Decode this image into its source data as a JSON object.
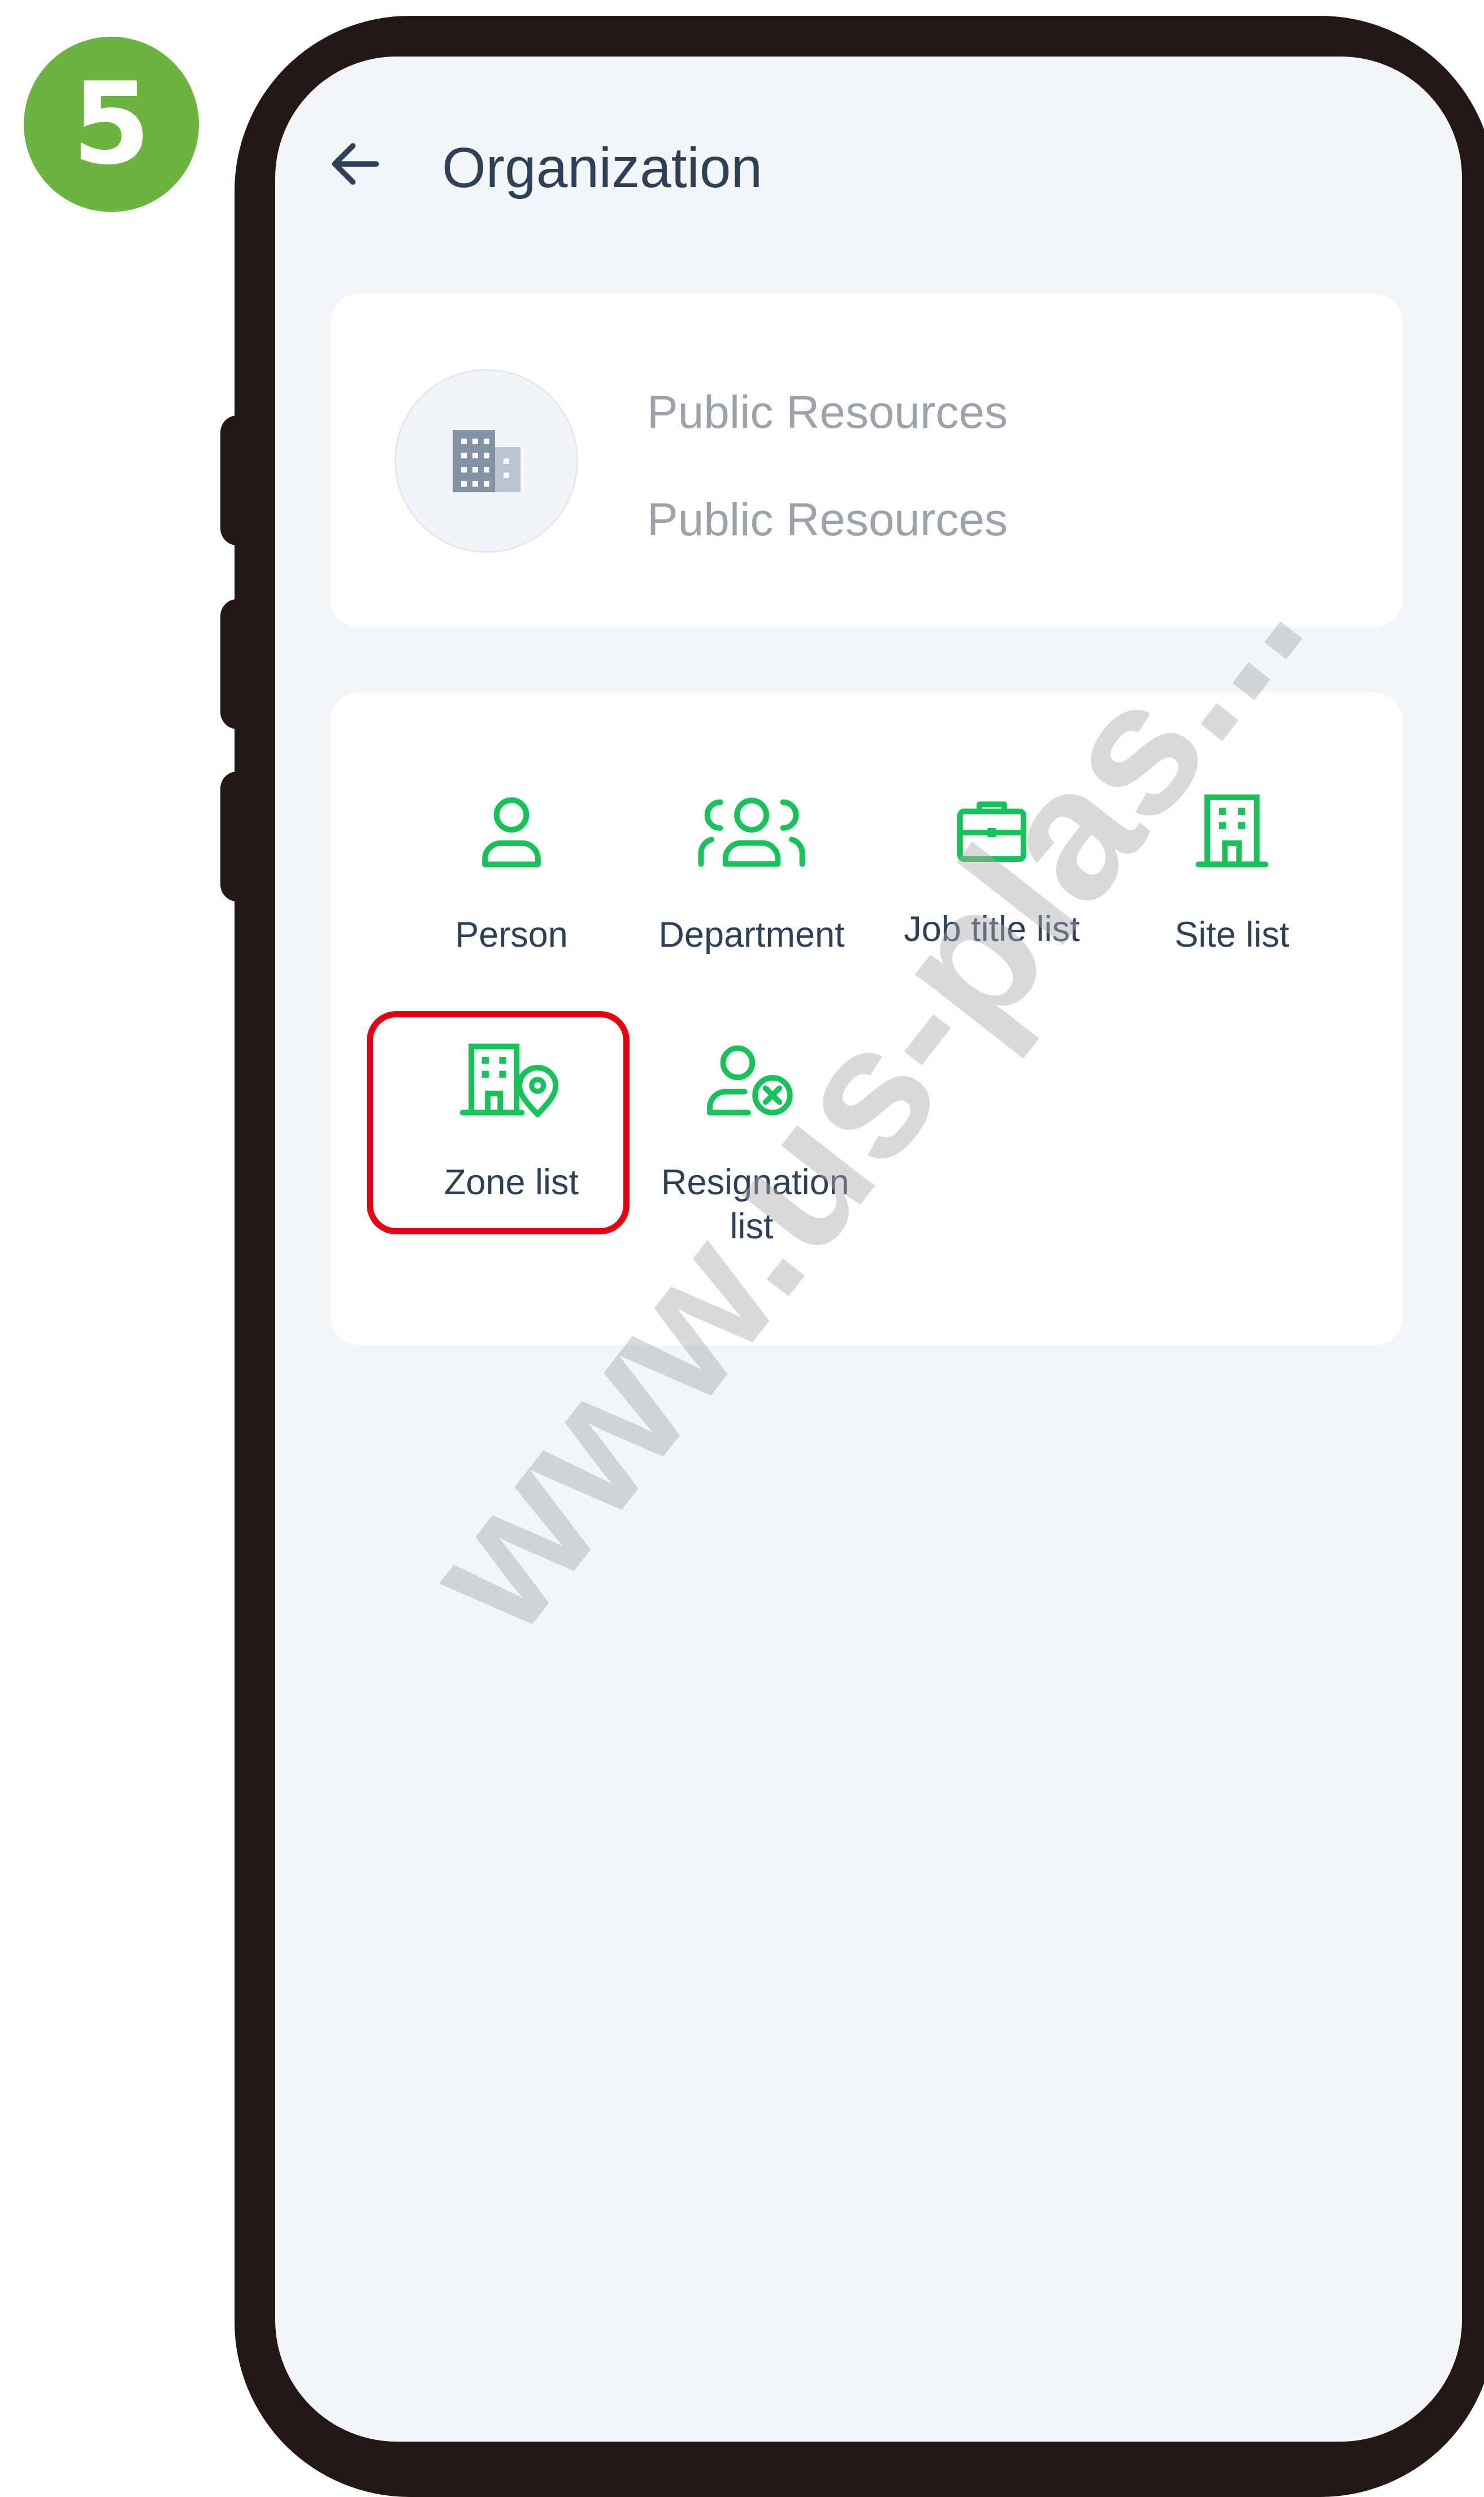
{
  "step": {
    "number": "5",
    "color": "#6cb33f"
  },
  "header": {
    "title": "Organization",
    "back_icon": "arrow-left-icon"
  },
  "org_card": {
    "icon": "building-icon",
    "name": "Public Resources",
    "subtitle": "Public Resources"
  },
  "menu": {
    "accent_color": "#18c25a",
    "items": [
      {
        "label": "Person",
        "icon": "person-icon"
      },
      {
        "label": "Department",
        "icon": "group-icon"
      },
      {
        "label": "Job title list",
        "icon": "briefcase-icon"
      },
      {
        "label": "Site list",
        "icon": "building-icon"
      },
      {
        "label": "Zone list",
        "icon": "building-pin-icon",
        "highlighted": true
      },
      {
        "label": "Resignation list",
        "icon": "person-remove-icon"
      }
    ]
  },
  "highlight_color": "#e60012",
  "watermark": "www.us-plas..."
}
